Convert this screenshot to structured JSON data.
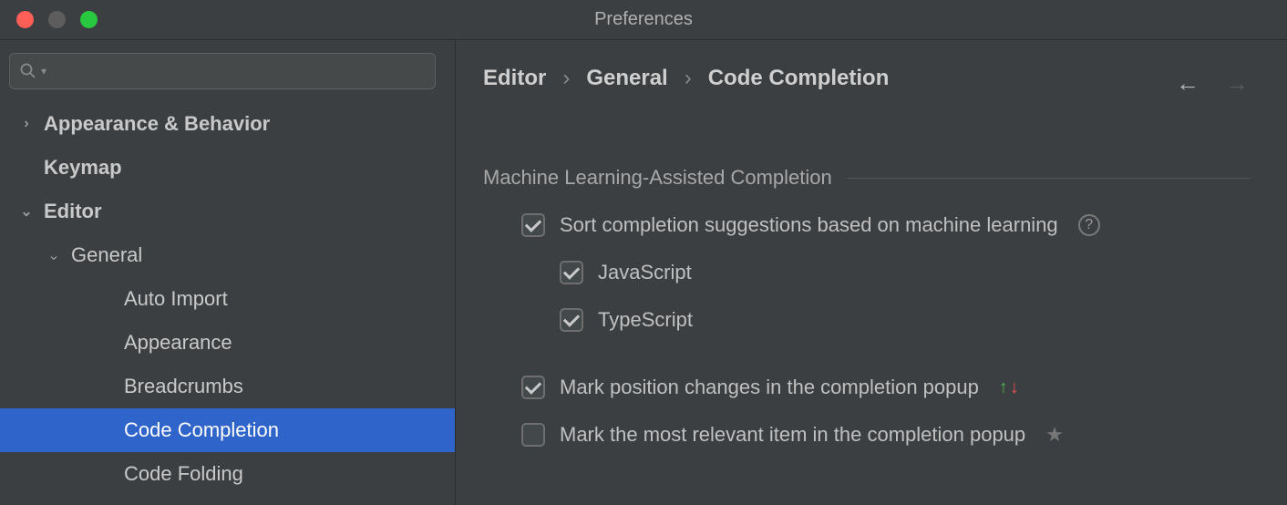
{
  "window": {
    "title": "Preferences"
  },
  "search": {
    "placeholder": ""
  },
  "sidebar": {
    "items": [
      {
        "label": "Appearance & Behavior",
        "bold": true,
        "arrow": "right",
        "indent": 0
      },
      {
        "label": "Keymap",
        "bold": true,
        "arrow": "none",
        "indent": 0
      },
      {
        "label": "Editor",
        "bold": true,
        "arrow": "down",
        "indent": 0
      },
      {
        "label": "General",
        "bold": false,
        "arrow": "down",
        "indent": 1
      },
      {
        "label": "Auto Import",
        "bold": false,
        "arrow": "none",
        "indent": 2
      },
      {
        "label": "Appearance",
        "bold": false,
        "arrow": "none",
        "indent": 2
      },
      {
        "label": "Breadcrumbs",
        "bold": false,
        "arrow": "none",
        "indent": 2
      },
      {
        "label": "Code Completion",
        "bold": false,
        "arrow": "none",
        "indent": 2,
        "selected": true
      },
      {
        "label": "Code Folding",
        "bold": false,
        "arrow": "none",
        "indent": 2
      }
    ]
  },
  "breadcrumb": {
    "items": [
      "Editor",
      "General",
      "Code Completion"
    ]
  },
  "section": {
    "title": "Machine Learning-Assisted Completion"
  },
  "options": {
    "sort": {
      "label": "Sort completion suggestions based on machine learning",
      "checked": true
    },
    "javascript": {
      "label": "JavaScript",
      "checked": true
    },
    "typescript": {
      "label": "TypeScript",
      "checked": true
    },
    "mark_position": {
      "label": "Mark position changes in the completion popup",
      "checked": true
    },
    "mark_relevant": {
      "label": "Mark the most relevant item in the completion popup",
      "checked": false
    }
  }
}
